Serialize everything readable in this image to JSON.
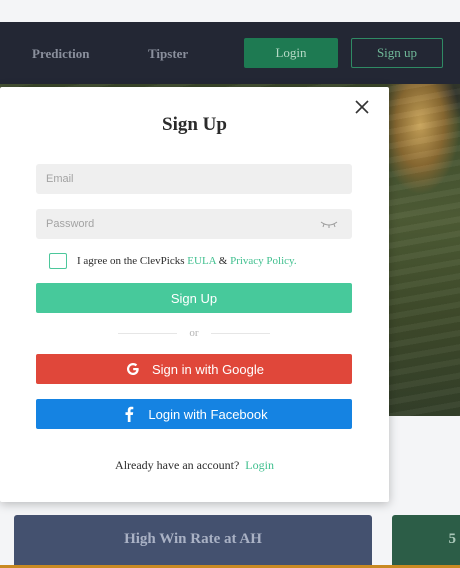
{
  "nav": {
    "prediction": "Prediction",
    "tipster": "Tipster",
    "login": "Login",
    "signup": "Sign up"
  },
  "cards": {
    "card1_title": "High Win Rate at AH",
    "card2_title": "5"
  },
  "modal": {
    "title": "Sign Up",
    "email_placeholder": "Email",
    "password_placeholder": "Password",
    "agree_prefix": "I agree on the ClevPicks ",
    "eula": "EULA",
    "and": " & ",
    "privacy": "Privacy Policy.",
    "signup_button": "Sign Up",
    "or": "or",
    "google_button": "Sign in with Google",
    "facebook_button": "Login with Facebook",
    "account_text": "Already have an account?",
    "login_link": "Login"
  },
  "icons": {
    "close": "close-icon",
    "eye": "eye-closed-icon",
    "google": "google-icon",
    "facebook": "facebook-icon"
  },
  "colors": {
    "accent_green": "#47c99b",
    "google_red": "#e0473a",
    "facebook_blue": "#1583e2",
    "nav_bg": "#232734"
  }
}
